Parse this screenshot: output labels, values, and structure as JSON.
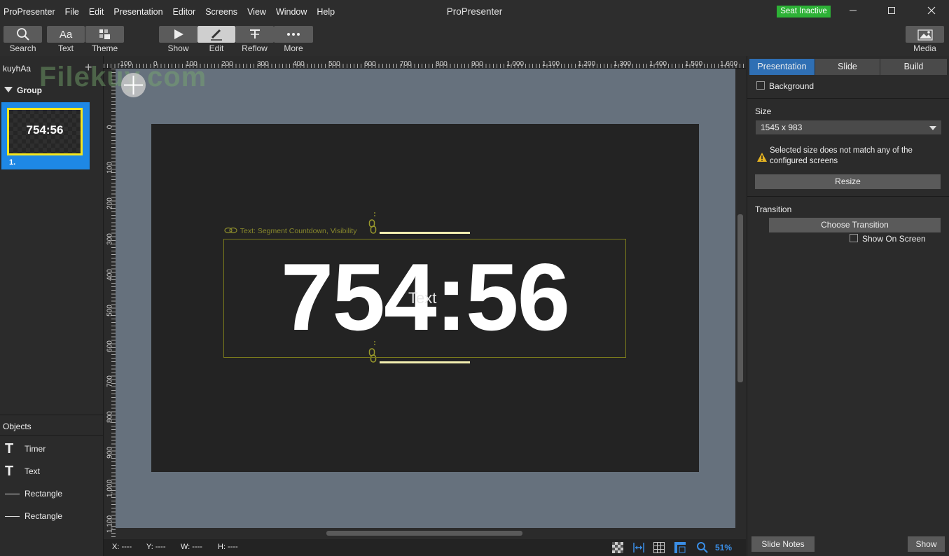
{
  "menu": [
    "ProPresenter",
    "File",
    "Edit",
    "Presentation",
    "Editor",
    "Screens",
    "View",
    "Window",
    "Help"
  ],
  "app_title": "ProPresenter",
  "seat_status": "Seat Inactive",
  "toolbar": {
    "search": "Search",
    "text": "Text",
    "theme": "Theme",
    "show": "Show",
    "edit": "Edit",
    "reflow": "Reflow",
    "more": "More",
    "media": "Media"
  },
  "left": {
    "library_name": "kuyhAa",
    "group_label": "Group",
    "slide_thumb_text": "754:56",
    "slide_number": "1.",
    "objects_header": "Objects",
    "objects": [
      {
        "icon": "text-icon",
        "label": "Timer"
      },
      {
        "icon": "text-icon",
        "label": "Text"
      },
      {
        "icon": "line-icon",
        "label": "Rectangle"
      },
      {
        "icon": "line-icon",
        "label": "Rectangle"
      }
    ]
  },
  "ruler": {
    "h_labels": [
      "-100",
      "0",
      "100",
      "200",
      "300",
      "400",
      "500",
      "600",
      "700",
      "800",
      "900",
      "1,000",
      "1,100",
      "1,200",
      "1,300",
      "1,400",
      "1,500",
      "1,600"
    ],
    "v_labels": [
      "0",
      "100",
      "200",
      "300",
      "400",
      "500",
      "600",
      "700",
      "800",
      "900",
      "1,000",
      "1,100"
    ]
  },
  "watermark": "Filekuy.com",
  "canvas": {
    "link_label": "Text: Segment Countdown, Visibility",
    "timer_text": "754:56",
    "overlay_text": "Text"
  },
  "status": {
    "x": "X: ----",
    "y": "Y: ----",
    "w": "W: ----",
    "h": "H: ----",
    "zoom": "51%"
  },
  "right": {
    "tabs": [
      "Presentation",
      "Slide",
      "Build"
    ],
    "background_label": "Background",
    "size_label": "Size",
    "size_value": "1545 x 983",
    "warning_text_1": "Selected size does not match any of the",
    "warning_text_2": "configured screens",
    "resize_button": "Resize",
    "transition_label": "Transition",
    "choose_transition": "Choose Transition",
    "show_on_screen": "Show On Screen",
    "slide_notes": "Slide Notes",
    "show_button": "Show"
  },
  "colors": {
    "accent_blue": "#2f6fb4",
    "seat_green": "#2db236",
    "selection_yellow": "#f5e61e",
    "canvas_bg": "#66717d"
  }
}
